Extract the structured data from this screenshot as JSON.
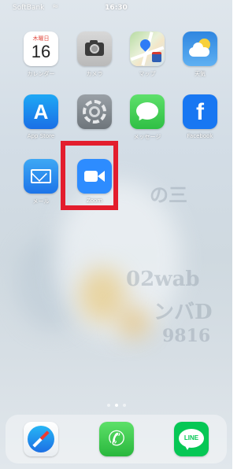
{
  "status_bar": {
    "carrier": "SoftBank",
    "wifi_icon": "wifi-icon",
    "time": "16:30"
  },
  "apps": {
    "calendar": {
      "label": "カレンダー",
      "weekday": "木曜日",
      "day": "16",
      "icon": "calendar-icon"
    },
    "camera": {
      "label": "カメラ",
      "icon": "camera-icon"
    },
    "maps": {
      "label": "マップ",
      "icon": "maps-icon"
    },
    "weather": {
      "label": "天気",
      "icon": "weather-icon"
    },
    "appstore": {
      "label": "App Store",
      "glyph": "A",
      "icon": "app-store-icon"
    },
    "settings": {
      "label": "",
      "icon": "settings-gear-icon"
    },
    "messages": {
      "label": "メッセージ",
      "icon": "messages-icon"
    },
    "facebook": {
      "label": "Facebook",
      "glyph": "f",
      "icon": "facebook-icon"
    },
    "mail": {
      "label": "メール",
      "icon": "mail-icon"
    },
    "zoom": {
      "label": "Zoom",
      "icon": "zoom-video-icon",
      "highlighted": true
    }
  },
  "wallpaper_text": [
    "の三",
    "02wab",
    "ンバD",
    "9816"
  ],
  "page_indicator": {
    "pages": 3,
    "active": 1
  },
  "dock": {
    "safari": {
      "icon": "safari-compass-icon"
    },
    "phone": {
      "icon": "phone-icon",
      "glyph": "✆"
    },
    "line": {
      "icon": "line-icon",
      "text": "LINE"
    }
  },
  "colors": {
    "highlight": "#e31d2d",
    "zoom_blue": "#2d8cff",
    "facebook_blue": "#1877f2",
    "line_green": "#06c755"
  }
}
